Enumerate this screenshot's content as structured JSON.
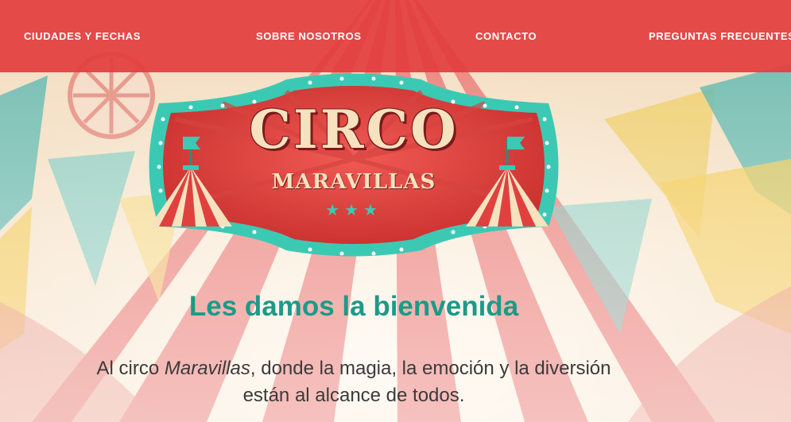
{
  "nav": {
    "items": [
      {
        "label": "CIUDADES Y FECHAS"
      },
      {
        "label": "SOBRE NOSOTROS"
      },
      {
        "label": "CONTACTO"
      },
      {
        "label": "PREGUNTAS FRECUENTES"
      }
    ]
  },
  "logo": {
    "title": "CIRCO",
    "subtitle": "MARAVILLAS",
    "stars": "★★★"
  },
  "welcome": {
    "title": "Les damos la bienvenida",
    "text_before": "Al circo ",
    "text_em": "Maravillas",
    "text_after": ", donde la magia, la emoción y la diversión",
    "text_line2": "están al alcance de todos."
  },
  "colors": {
    "navbar": "#e23e3e",
    "accent_teal": "#1c9a88",
    "logo_red": "#e0413f",
    "logo_border": "#3cc9b4",
    "cream": "#f6e2bf"
  }
}
